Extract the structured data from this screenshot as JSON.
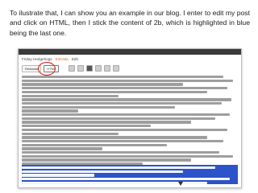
{
  "caption": "To ilustrate that, I can show you an example in our blog. I enter to edit my post and click on HTML, then I stick the content of 2b, which is highlighted in blue being the last one.",
  "blog": {
    "title": "Friday Hedgehogs",
    "entry_link": "Entrada",
    "edit_prefix": "Edit"
  },
  "editor_tabs": {
    "compose": "Redactar",
    "html": "HTML"
  },
  "colors": {
    "selection": "#2c53c9",
    "highlight_circle": "#d81b1b",
    "title_link": "#e06c1f"
  }
}
